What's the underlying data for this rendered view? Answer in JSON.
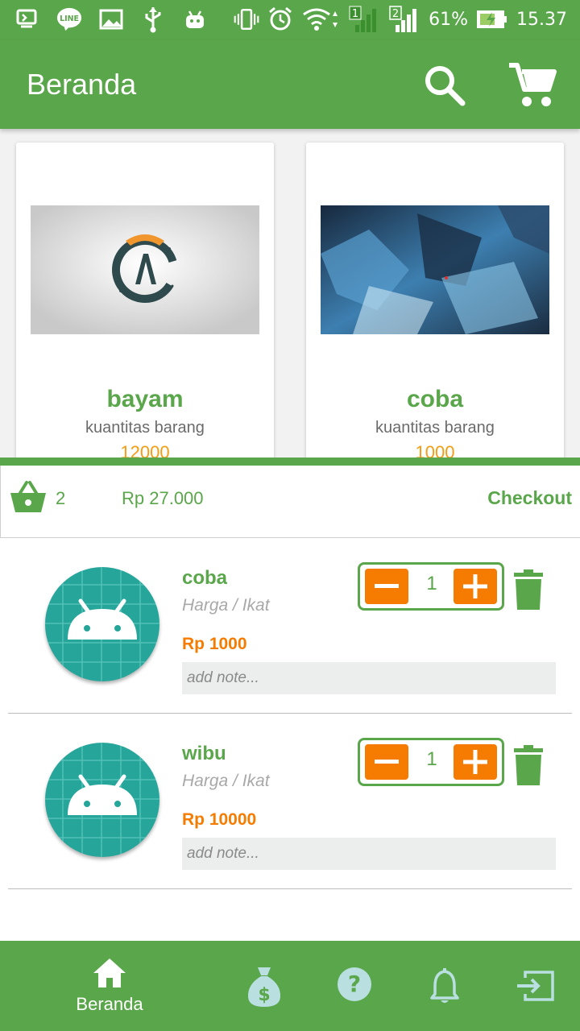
{
  "status_bar": {
    "battery": "61%",
    "time": "15.37",
    "left_icons": [
      "screen-cast-icon",
      "line-app-icon",
      "image-icon",
      "usb-icon",
      "android-debug-icon"
    ],
    "right_icons": [
      "vibrate-icon",
      "alarm-icon",
      "wifi-icon",
      "signal-sim1-icon",
      "signal-sim2-icon",
      "battery-charging-icon"
    ],
    "sim1": "1",
    "sim2": "2"
  },
  "app_bar": {
    "title": "Beranda",
    "actions": [
      "search-icon",
      "cart-icon"
    ]
  },
  "products": [
    {
      "name": "bayam",
      "qty_label": "kuantitas barang",
      "qty": "12000",
      "image": "overwatch-logo-image"
    },
    {
      "name": "coba",
      "qty_label": "kuantitas barang",
      "qty": "1000",
      "image": "blue-abstract-art-image"
    }
  ],
  "cart": {
    "count": "2",
    "total": "Rp 27.000",
    "checkout_label": "Checkout",
    "items": [
      {
        "name": "coba",
        "unit": "Harga / Ikat",
        "price": "Rp 1000",
        "quantity": "1",
        "note_placeholder": "add note..."
      },
      {
        "name": "wibu",
        "unit": "Harga / Ikat",
        "price": "Rp 10000",
        "quantity": "1",
        "note_placeholder": "add note..."
      }
    ]
  },
  "bottom_nav": {
    "items": [
      {
        "icon": "home-icon",
        "label": "Beranda",
        "active": true
      },
      {
        "icon": "money-bag-icon",
        "label": "",
        "active": false
      },
      {
        "icon": "help-icon",
        "label": "",
        "active": false
      },
      {
        "icon": "bell-icon",
        "label": "",
        "active": false
      },
      {
        "icon": "logout-icon",
        "label": "",
        "active": false
      }
    ]
  },
  "colors": {
    "primary_green": "#5aa64a",
    "accent_orange": "#f57c00",
    "qty_orange": "#f39c12",
    "avatar_teal": "#26a69a",
    "nav_inactive": "#b9dfe0"
  }
}
